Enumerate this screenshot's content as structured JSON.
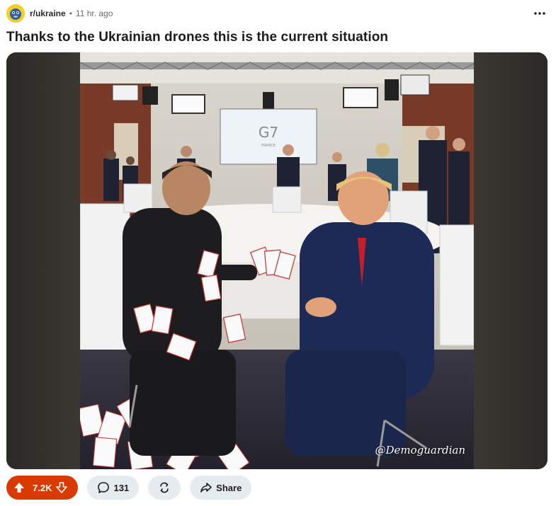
{
  "post": {
    "subreddit": "r/ukraine",
    "separator": "•",
    "age": "11 hr. ago",
    "more_icon": "ellipsis-icon",
    "title": "Thanks to the Ukrainian drones this is the current situation"
  },
  "media": {
    "screen_text": "G7",
    "screen_subtext": "FRANCE",
    "watermark": "@Demoguardian"
  },
  "actions": {
    "votes": "7.2K",
    "comments": "131",
    "share": "Share"
  },
  "colors": {
    "upvote_bg": "#d93a00",
    "pill_bg": "#e5ebee",
    "text": "#1c1c1c",
    "meta": "#6b6b6b"
  },
  "icons": [
    "subreddit-avatar-icon",
    "ellipsis-icon",
    "upvote-icon",
    "downvote-icon",
    "comment-icon",
    "award-icon",
    "share-icon"
  ]
}
